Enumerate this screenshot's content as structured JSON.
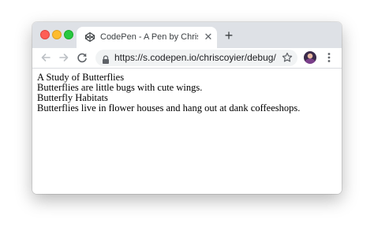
{
  "browser": {
    "tab": {
      "title": "CodePen - A Pen by Chris Coyier",
      "close_icon": "close-icon",
      "favicon": "codepen-logo-icon"
    },
    "new_tab_icon": "plus-icon",
    "toolbar": {
      "back_icon": "arrow-left-icon",
      "forward_icon": "arrow-right-icon",
      "reload_icon": "reload-icon",
      "lock_icon": "lock-icon",
      "url": "https://s.codepen.io/chriscoyier/debug/...",
      "bookmark_icon": "star-icon",
      "profile_icon": "avatar",
      "menu_icon": "kebab-menu-icon"
    },
    "traffic_lights": {
      "close_color": "#fe5f57",
      "minimize_color": "#febc2e",
      "maximize_color": "#28c840"
    }
  },
  "page": {
    "lines": [
      "A Study of Butterflies",
      "Butterflies are little bugs with cute wings.",
      "Butterfly Habitats",
      "Butterflies live in flower houses and hang out at dank coffeeshops."
    ]
  }
}
